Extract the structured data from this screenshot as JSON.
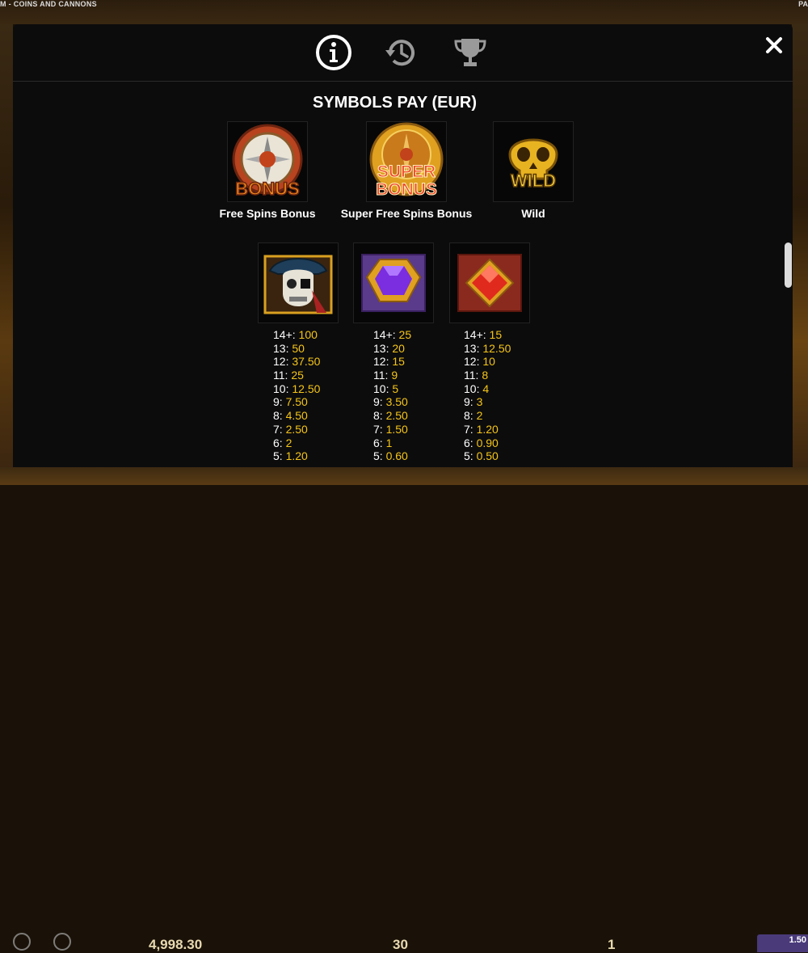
{
  "game": {
    "title_left": "M - COINS AND CANNONS",
    "title_right": "PA",
    "balance": "4,998.30",
    "bet": "30",
    "lines": "1",
    "bet_button": "1.50"
  },
  "header": {
    "tabs": [
      {
        "name": "info",
        "icon": "info-icon",
        "active": true
      },
      {
        "name": "history",
        "icon": "history-icon",
        "active": false
      },
      {
        "name": "trophy",
        "icon": "trophy-icon",
        "active": false
      }
    ],
    "close_icon": "close-icon"
  },
  "section": {
    "title": "SYMBOLS PAY (EUR)"
  },
  "special_symbols": [
    {
      "label": "Free Spins Bonus",
      "icon": "bonus-compass-icon",
      "text": "BONUS"
    },
    {
      "label": "Super Free Spins Bonus",
      "icon": "super-bonus-compass-icon",
      "text_top": "SUPER",
      "text_bottom": "BONUS"
    },
    {
      "label": "Wild",
      "icon": "wild-skull-icon",
      "text": "WILD"
    }
  ],
  "pay_symbols": [
    {
      "icon": "pirate-skull-icon",
      "pays": [
        {
          "count": "14+:",
          "value": "100"
        },
        {
          "count": "13:",
          "value": "50"
        },
        {
          "count": "12:",
          "value": "37.50"
        },
        {
          "count": "11:",
          "value": "25"
        },
        {
          "count": "10:",
          "value": "12.50"
        },
        {
          "count": "9:",
          "value": "7.50"
        },
        {
          "count": "8:",
          "value": "4.50"
        },
        {
          "count": "7:",
          "value": "2.50"
        },
        {
          "count": "6:",
          "value": "2"
        },
        {
          "count": "5:",
          "value": "1.20"
        }
      ]
    },
    {
      "icon": "purple-gem-icon",
      "pays": [
        {
          "count": "14+:",
          "value": "25"
        },
        {
          "count": "13:",
          "value": "20"
        },
        {
          "count": "12:",
          "value": "15"
        },
        {
          "count": "11:",
          "value": "9"
        },
        {
          "count": "10:",
          "value": "5"
        },
        {
          "count": "9:",
          "value": "3.50"
        },
        {
          "count": "8:",
          "value": "2.50"
        },
        {
          "count": "7:",
          "value": "1.50"
        },
        {
          "count": "6:",
          "value": "1"
        },
        {
          "count": "5:",
          "value": "0.60"
        }
      ]
    },
    {
      "icon": "red-gem-icon",
      "pays": [
        {
          "count": "14+:",
          "value": "15"
        },
        {
          "count": "13:",
          "value": "12.50"
        },
        {
          "count": "12:",
          "value": "10"
        },
        {
          "count": "11:",
          "value": "8"
        },
        {
          "count": "10:",
          "value": "4"
        },
        {
          "count": "9:",
          "value": "3"
        },
        {
          "count": "8:",
          "value": "2"
        },
        {
          "count": "7:",
          "value": "1.20"
        },
        {
          "count": "6:",
          "value": "0.90"
        },
        {
          "count": "5:",
          "value": "0.50"
        }
      ]
    }
  ],
  "colors": {
    "modal_bg": "#0c0c0c",
    "pay_value": "#f5c518",
    "text": "#ffffff"
  }
}
